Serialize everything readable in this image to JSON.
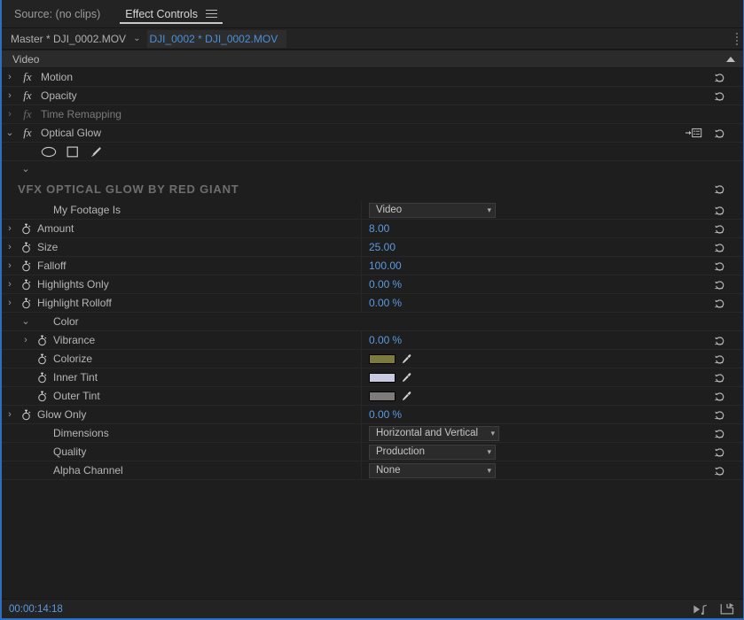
{
  "panel": {
    "tabs": [
      {
        "label": "Source: (no clips)",
        "active": false,
        "name": "tab-source"
      },
      {
        "label": "Effect Controls",
        "active": true,
        "name": "tab-effect-controls"
      }
    ],
    "menu_icon": "hamburger-menu-icon"
  },
  "clipbar": {
    "master_label": "Master * DJI_0002.MOV",
    "chevron": "⌄",
    "active_clip": "DJI_0002 * DJI_0002.MOV",
    "handle_icon": "drag-handle-icon"
  },
  "video_section": {
    "title": "Video",
    "collapse_icon": "triangle-up-icon"
  },
  "effects": [
    {
      "name": "Motion",
      "fx": "fx",
      "expanded": false,
      "dim": false,
      "reset": true,
      "chevron": "›"
    },
    {
      "name": "Opacity",
      "fx": "fx",
      "expanded": false,
      "dim": false,
      "reset": true,
      "chevron": "›"
    },
    {
      "name": "Time Remapping",
      "fx": "fx",
      "expanded": false,
      "dim": true,
      "reset": false,
      "chevron": "›"
    },
    {
      "name": "Optical Glow",
      "fx": "fx",
      "expanded": true,
      "dim": false,
      "reset": true,
      "chevron": "⌄",
      "mask_icon": "mask-reference-icon"
    }
  ],
  "mask_tools": [
    {
      "label": "ellipse-mask-tool",
      "icon": "ellipse-icon"
    },
    {
      "label": "rectangle-mask-tool",
      "icon": "rectangle-icon"
    },
    {
      "label": "pen-mask-tool",
      "icon": "pen-icon"
    }
  ],
  "group": {
    "chevron": "⌄",
    "title": "VFX OPTICAL GLOW BY RED GIANT",
    "reset": true
  },
  "parameters": [
    {
      "label": "My Footage Is",
      "indent": 2,
      "type": "dropdown",
      "value": "Video",
      "stopwatch": false,
      "chevron": null,
      "reset": true
    },
    {
      "label": "Amount",
      "indent": 1,
      "type": "number",
      "value": "8.00",
      "unit": "",
      "stopwatch": true,
      "chevron": "›",
      "reset": true
    },
    {
      "label": "Size",
      "indent": 1,
      "type": "number",
      "value": "25.00",
      "unit": "",
      "stopwatch": true,
      "chevron": "›",
      "reset": true
    },
    {
      "label": "Falloff",
      "indent": 1,
      "type": "number",
      "value": "100.00",
      "unit": "",
      "stopwatch": true,
      "chevron": "›",
      "reset": true
    },
    {
      "label": "Highlights Only",
      "indent": 1,
      "type": "number",
      "value": "0.00",
      "unit": "%",
      "stopwatch": true,
      "chevron": "›",
      "reset": true
    },
    {
      "label": "Highlight Rolloff",
      "indent": 1,
      "type": "number",
      "value": "0.00",
      "unit": "%",
      "stopwatch": true,
      "chevron": "›",
      "reset": true
    },
    {
      "label": "Color",
      "indent": 2,
      "type": "group",
      "value": "",
      "unit": "",
      "stopwatch": false,
      "chevron": "⌄",
      "reset": false,
      "expanded": true
    },
    {
      "label": "Vibrance",
      "indent": 2,
      "type": "number",
      "value": "0.00",
      "unit": "%",
      "stopwatch": true,
      "chevron": "›",
      "reset": true,
      "deep": true
    },
    {
      "label": "Colorize",
      "indent": 2,
      "type": "color",
      "value": "#7c7a3d",
      "stopwatch": true,
      "chevron": null,
      "reset": true,
      "deep": true,
      "eyedropper": "eyedropper-icon"
    },
    {
      "label": "Inner Tint",
      "indent": 2,
      "type": "color",
      "value": "#c7cae1",
      "stopwatch": true,
      "chevron": null,
      "reset": true,
      "deep": true,
      "eyedropper": "eyedropper-icon"
    },
    {
      "label": "Outer Tint",
      "indent": 2,
      "type": "color",
      "value": "#7b7b7b",
      "stopwatch": true,
      "chevron": null,
      "reset": true,
      "deep": true,
      "eyedropper": "eyedropper-icon"
    },
    {
      "label": "Glow Only",
      "indent": 1,
      "type": "number",
      "value": "0.00",
      "unit": "%",
      "stopwatch": true,
      "chevron": "›",
      "reset": true
    },
    {
      "label": "Dimensions",
      "indent": 2,
      "type": "dropdown",
      "value": "Horizontal and Vertical",
      "stopwatch": false,
      "chevron": null,
      "reset": true
    },
    {
      "label": "Quality",
      "indent": 2,
      "type": "dropdown",
      "value": "Production",
      "stopwatch": false,
      "chevron": null,
      "reset": true
    },
    {
      "label": "Alpha Channel",
      "indent": 2,
      "type": "dropdown",
      "value": "None",
      "stopwatch": false,
      "chevron": null,
      "reset": true
    }
  ],
  "statusbar": {
    "timecode": "00:00:14:18",
    "icons": [
      {
        "name": "play-audio-icon"
      },
      {
        "name": "export-frame-icon"
      }
    ]
  },
  "colors": {
    "accent_blue": "#5b9adf",
    "panel_bg": "#1e1e1e",
    "header_bg": "#2b2b2b",
    "focus_border": "#2d6fbe",
    "text": "#b6b6b6"
  }
}
